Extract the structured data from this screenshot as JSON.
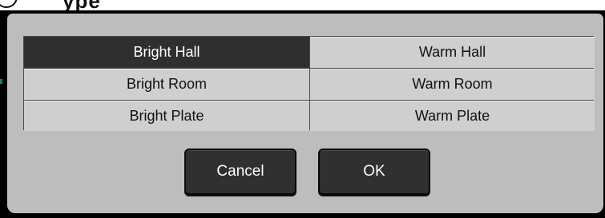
{
  "header": {
    "title_fragment": "ype"
  },
  "presets": {
    "options": [
      {
        "label": "Bright Hall",
        "selected": true
      },
      {
        "label": "Warm Hall",
        "selected": false
      },
      {
        "label": "Bright Room",
        "selected": false
      },
      {
        "label": "Warm Room",
        "selected": false
      },
      {
        "label": "Bright Plate",
        "selected": false
      },
      {
        "label": "Warm Plate",
        "selected": false
      }
    ]
  },
  "buttons": {
    "cancel_label": "Cancel",
    "ok_label": "OK"
  },
  "colors": {
    "selected_bg": "#2f2f2f",
    "cell_bg": "#cfcfcf",
    "dialog_bg": "#bdbdbd",
    "button_bg": "#303030"
  }
}
